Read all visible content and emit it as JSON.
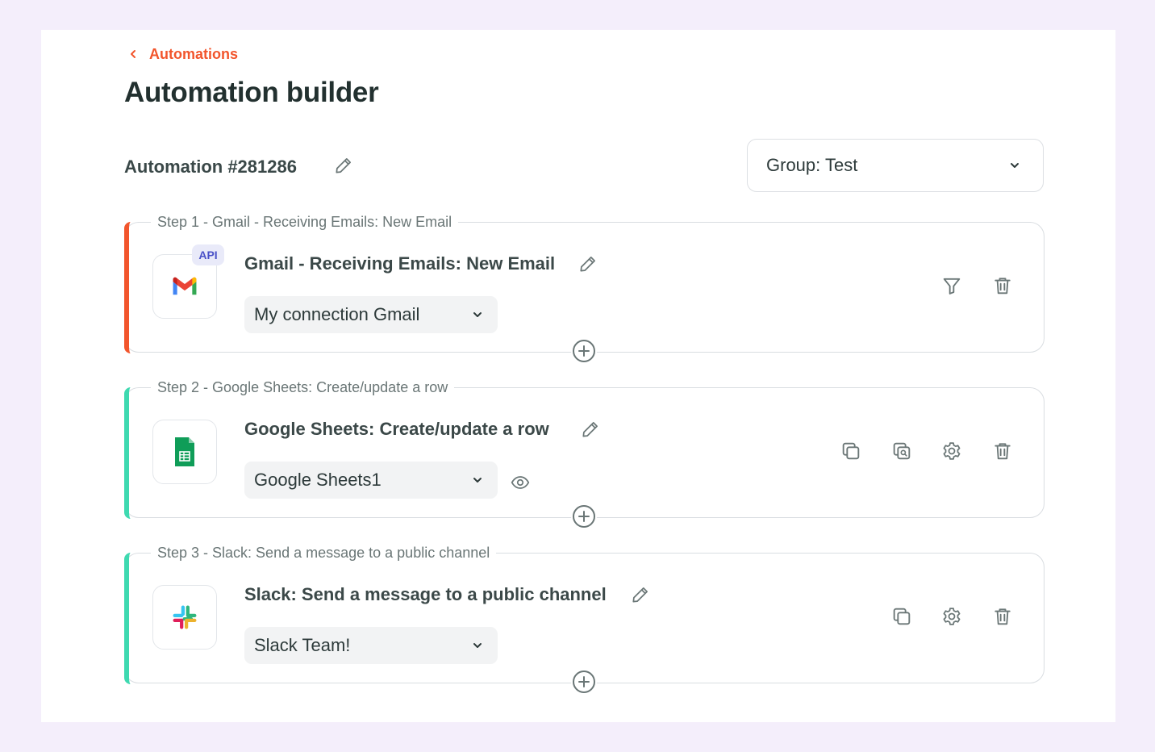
{
  "header": {
    "back_label": "Automations",
    "title": "Automation builder"
  },
  "automation": {
    "name": "Automation #281286",
    "group_select": "Group: Test"
  },
  "colors": {
    "brand": "#f2552c",
    "step1_accent": "#f2552c",
    "step_accent": "#3ed9b0",
    "api_badge": "#4b52c8"
  },
  "steps": [
    {
      "legend": "Step 1 - Gmail - Receiving Emails: New Email",
      "title": "Gmail - Receiving Emails: New Email",
      "app_icon": "gmail-icon",
      "badge": "API",
      "connection": "My connection Gmail",
      "actions": [
        "filter-icon",
        "trash-icon"
      ]
    },
    {
      "legend": "Step 2 - Google Sheets: Create/update a row",
      "title": "Google Sheets: Create/update a row",
      "app_icon": "google-sheets-icon",
      "connection": "Google Sheets1",
      "actions": [
        "duplicate-icon",
        "duplicate-search-icon",
        "gear-icon",
        "trash-icon"
      ]
    },
    {
      "legend": "Step 3 - Slack: Send a message to a public channel",
      "title": "Slack: Send a message to a public channel",
      "app_icon": "slack-icon",
      "connection": "Slack Team!",
      "actions": [
        "duplicate-icon",
        "gear-icon",
        "trash-icon"
      ]
    }
  ]
}
